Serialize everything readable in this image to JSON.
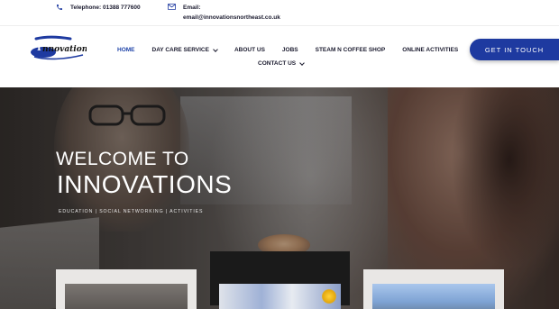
{
  "contact": {
    "phone_label": "Telephone: 01388 777600",
    "email_label": "Email:",
    "email_value": "email@innovationsnortheast.co.uk"
  },
  "brand": {
    "logo_text": "Innovations",
    "accent_color": "#1e3aa0"
  },
  "nav": {
    "items": [
      {
        "label": "HOME",
        "active": true
      },
      {
        "label": "DAY CARE SERVICE",
        "dropdown": true
      },
      {
        "label": "ABOUT US"
      },
      {
        "label": "JOBS"
      },
      {
        "label": "STEAM N COFFEE SHOP"
      },
      {
        "label": "ONLINE ACTIVITIES"
      },
      {
        "label": "CONTACT US",
        "dropdown": true
      }
    ],
    "cta_label": "GET IN TOUCH"
  },
  "hero": {
    "title": "WELCOME TO",
    "subtitle": "INNOVATIONS",
    "tagline": "EDUCATION | SOCIAL NETWORKING | ACTIVITIES"
  }
}
